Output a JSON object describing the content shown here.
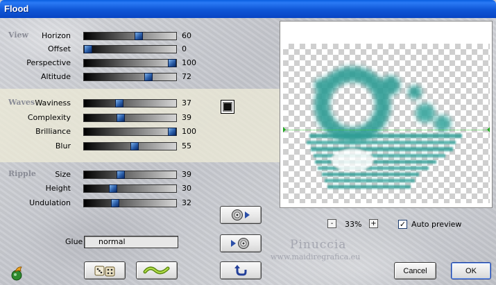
{
  "window": {
    "title": "Flood"
  },
  "groups": {
    "view": {
      "title": "View",
      "params": [
        {
          "label": "Horizon",
          "value": 60
        },
        {
          "label": "Offset",
          "value": 0
        },
        {
          "label": "Perspective",
          "value": 100
        },
        {
          "label": "Altitude",
          "value": 72
        }
      ]
    },
    "waves": {
      "title": "Waves",
      "params": [
        {
          "label": "Waviness",
          "value": 37
        },
        {
          "label": "Complexity",
          "value": 39
        },
        {
          "label": "Brilliance",
          "value": 100
        },
        {
          "label": "Blur",
          "value": 55
        }
      ]
    },
    "ripple": {
      "title": "Ripple",
      "params": [
        {
          "label": "Size",
          "value": 39
        },
        {
          "label": "Height",
          "value": 30
        },
        {
          "label": "Undulation",
          "value": 32
        }
      ]
    }
  },
  "glue": {
    "label": "Glue",
    "value": "normal"
  },
  "zoom": {
    "minus": "-",
    "value": "33%",
    "plus": "+"
  },
  "auto_preview": {
    "label": "Auto preview",
    "checked": true,
    "mark": "✓"
  },
  "buttons": {
    "cancel": "Cancel",
    "ok": "OK"
  },
  "watermark": {
    "name": "Pinuccia",
    "url": "www.maidiregrafica.eu"
  },
  "preview": {
    "object_color": "#2e9c94"
  },
  "icons": [
    "app-logo-icon",
    "random-dice-icon",
    "wave-preset-icon",
    "load-preset-icon",
    "save-preset-icon",
    "reset-icon"
  ]
}
